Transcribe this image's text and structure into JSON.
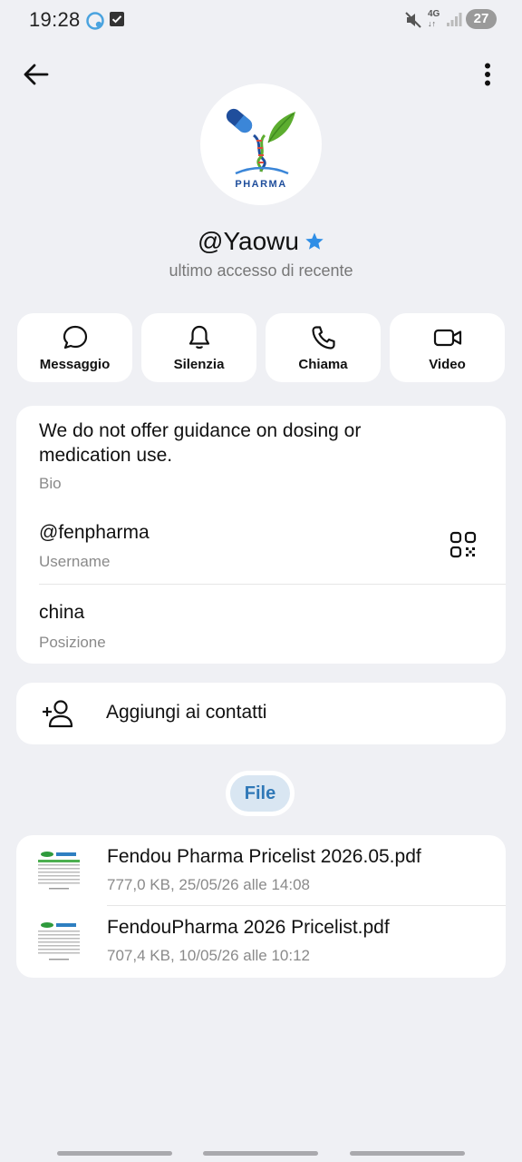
{
  "status_bar": {
    "time": "19:28",
    "network": "4G",
    "battery": "27"
  },
  "profile": {
    "name": "@Yaowu",
    "last_seen": "ultimo accesso di recente",
    "avatar_text": "PHARMA",
    "accent_color": "#2f8ee6"
  },
  "actions": [
    {
      "label": "Messaggio",
      "icon": "message-icon"
    },
    {
      "label": "Silenzia",
      "icon": "bell-icon"
    },
    {
      "label": "Chiama",
      "icon": "phone-icon"
    },
    {
      "label": "Video",
      "icon": "video-icon"
    }
  ],
  "info": {
    "bio": "We do not offer guidance on dosing or medication use.",
    "bio_label": "Bio",
    "username": "@fenpharma",
    "username_label": "Username",
    "location": "china",
    "location_label": "Posizione"
  },
  "add_contact": {
    "label": "Aggiungi ai contatti"
  },
  "tabs": {
    "file_label": "File"
  },
  "files": [
    {
      "name": "Fendou Pharma Pricelist 2026.05.pdf",
      "meta": "777,0 KB, 25/05/26 alle 14:08"
    },
    {
      "name": "FendouPharma 2026 Pricelist.pdf",
      "meta": "707,4 KB, 10/05/26 alle 10:12"
    }
  ]
}
